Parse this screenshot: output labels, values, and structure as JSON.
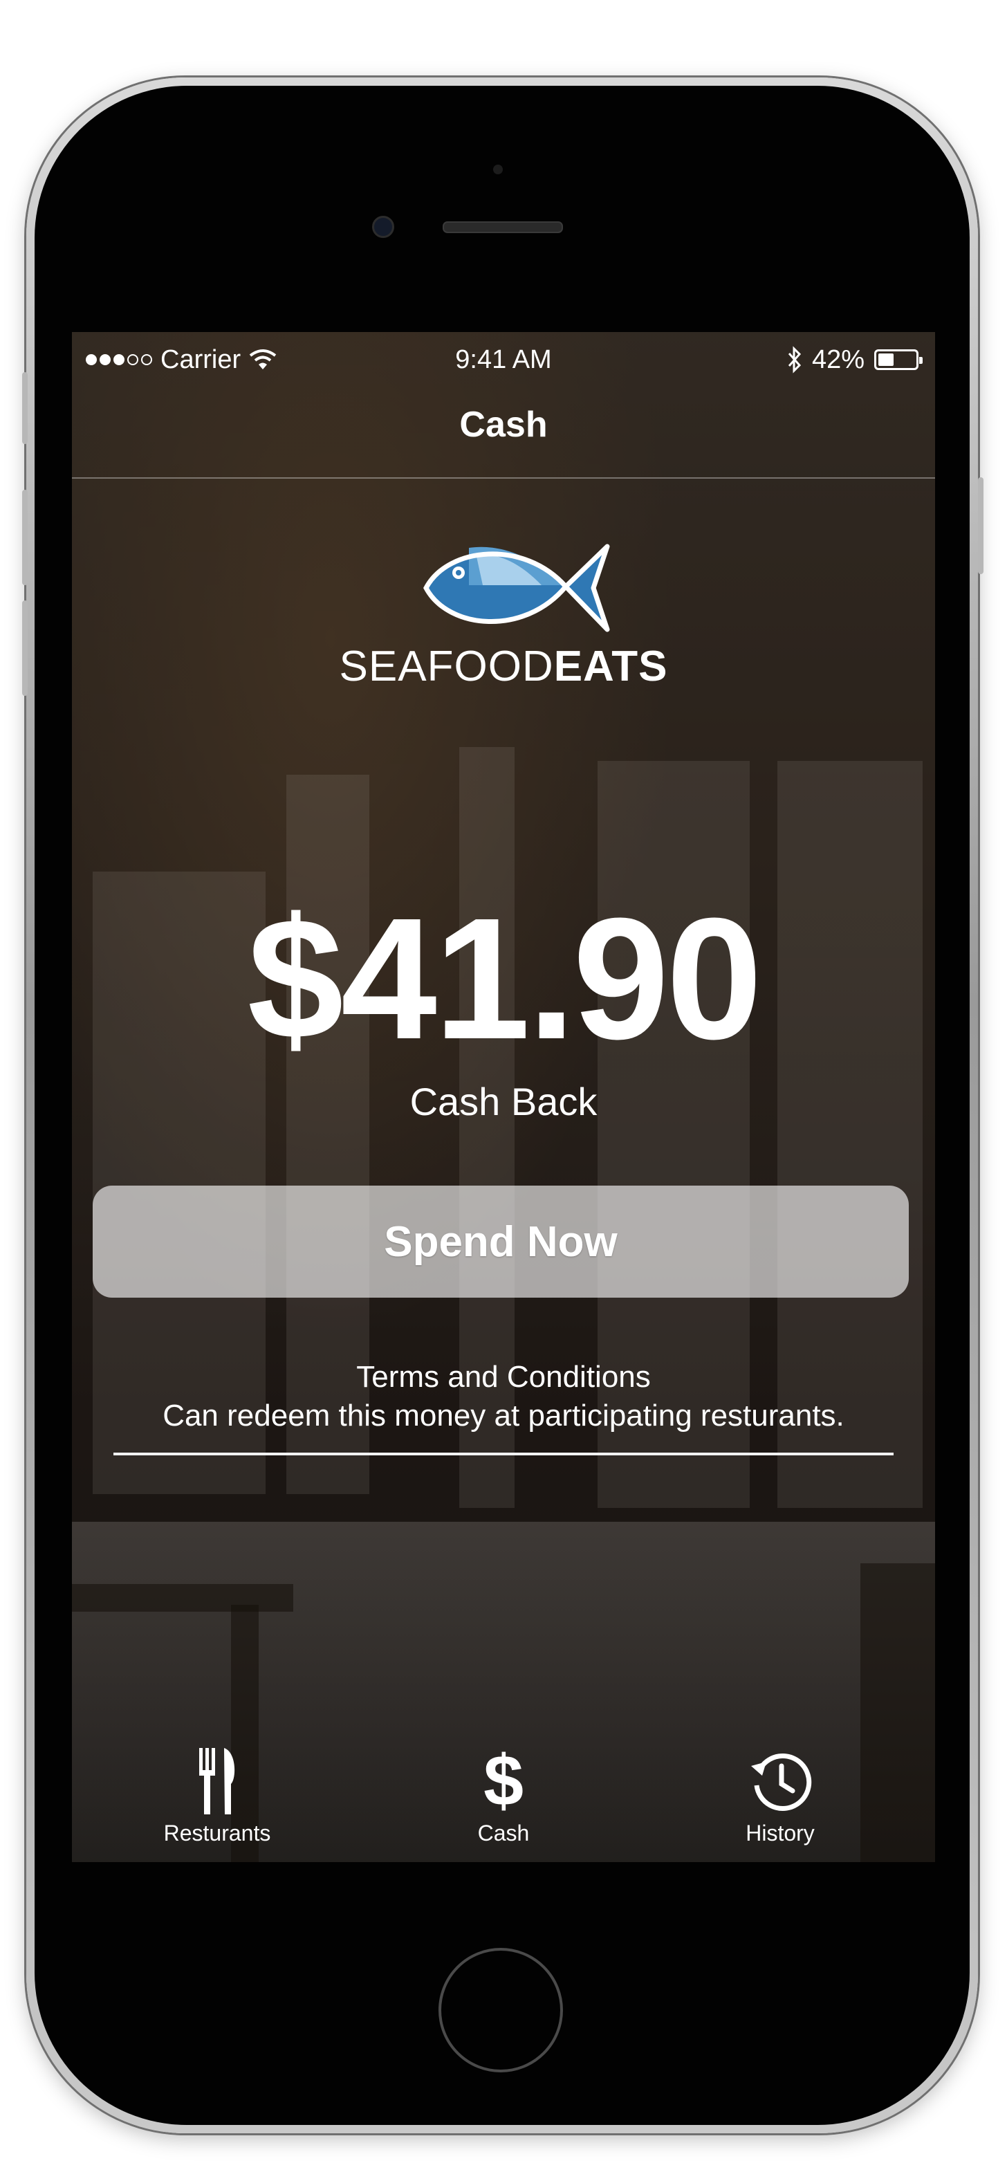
{
  "status_bar": {
    "carrier": "Carrier",
    "time": "9:41 AM",
    "battery_percent_label": "42%",
    "battery_level": 0.42
  },
  "nav": {
    "title": "Cash"
  },
  "brand": {
    "name_thin": "SEAFOOD",
    "name_bold": "EATS"
  },
  "balance": {
    "amount": "$41.90",
    "label": "Cash Back"
  },
  "actions": {
    "spend_label": "Spend Now"
  },
  "terms": {
    "title": "Terms and Conditions",
    "text": "Can redeem this money at participating resturants."
  },
  "tabs": [
    {
      "label": "Resturants",
      "icon": "fork-knife-icon"
    },
    {
      "label": "Cash",
      "icon": "dollar-icon"
    },
    {
      "label": "History",
      "icon": "history-clock-icon"
    }
  ],
  "colors": {
    "fish_dark": "#2f78b4",
    "fish_mid": "#5b9fd1",
    "fish_light": "#a9d0ec"
  }
}
